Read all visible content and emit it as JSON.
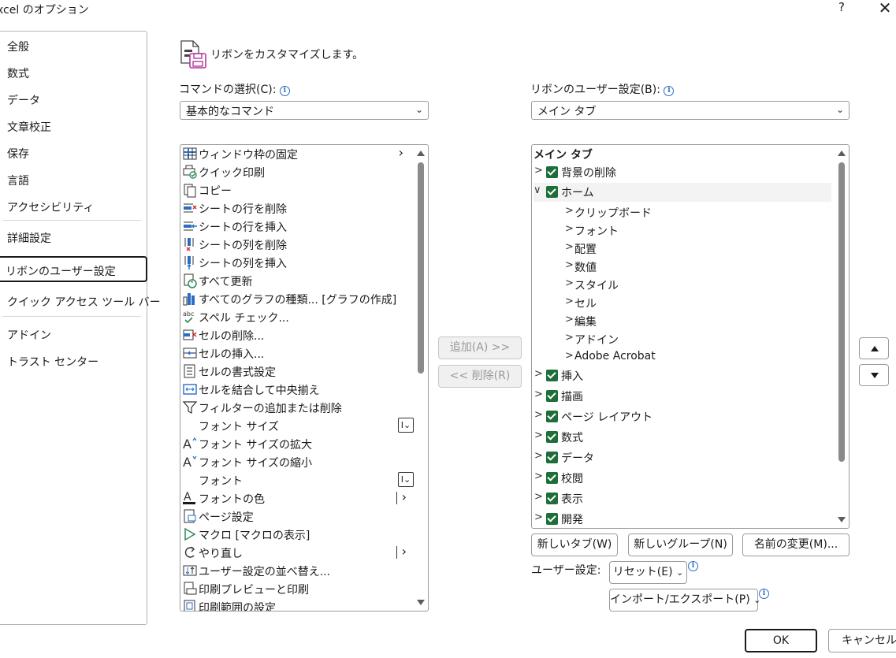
{
  "window": {
    "title": "xcel のオプション",
    "help": "?",
    "close": "✕"
  },
  "nav": {
    "items": [
      "全般",
      "数式",
      "データ",
      "文章校正",
      "保存",
      "言語",
      "アクセシビリティ",
      "詳細設定",
      "リボンのユーザー設定",
      "クイック アクセス ツール バー",
      "アドイン",
      "トラスト センター"
    ],
    "selected": "リボンのユーザー設定"
  },
  "heading": "リボンをカスタマイズします。",
  "commands": {
    "label": "コマンドの選択(C):",
    "dropdown_value": "基本的なコマンド",
    "items": [
      "ウィンドウ枠の固定",
      "クイック印刷",
      "コピー",
      "シートの行を削除",
      "シートの行を挿入",
      "シートの列を削除",
      "シートの列を挿入",
      "すべて更新",
      "すべてのグラフの種類... [グラフの作成]",
      "スペル チェック...",
      "セルの削除...",
      "セルの挿入...",
      "セルの書式設定",
      "セルを結合して中央揃え",
      "フィルターの追加または削除",
      "フォント サイズ",
      "フォント サイズの拡大",
      "フォント サイズの縮小",
      "フォント",
      "フォントの色",
      "ページ設定",
      "マクロ [マクロの表示]",
      "やり直し",
      "ユーザー設定の並べ替え...",
      "印刷プレビューと印刷",
      "印刷範囲の設定"
    ]
  },
  "add_button": "追加(A) >>",
  "remove_button": "<< 削除(R)",
  "ribbon": {
    "label": "リボンのユーザー設定(B):",
    "dropdown_value": "メイン タブ",
    "root": "メイン タブ",
    "tabs": [
      "背景の削除",
      "ホーム",
      "挿入",
      "描画",
      "ページ レイアウト",
      "数式",
      "データ",
      "校閲",
      "表示",
      "開発"
    ],
    "home_groups": [
      "クリップボード",
      "フォント",
      "配置",
      "数値",
      "スタイル",
      "セル",
      "編集",
      "アドイン",
      "Adobe Acrobat"
    ]
  },
  "buttons": {
    "new_tab": "新しいタブ(W)",
    "new_group": "新しいグループ(N)",
    "rename": "名前の変更(M)...",
    "customizations_label": "ユーザー設定:",
    "reset": "リセット(E)",
    "import_export": "インポート/エクスポート(P)",
    "ok": "OK",
    "cancel": "キャンセル"
  }
}
